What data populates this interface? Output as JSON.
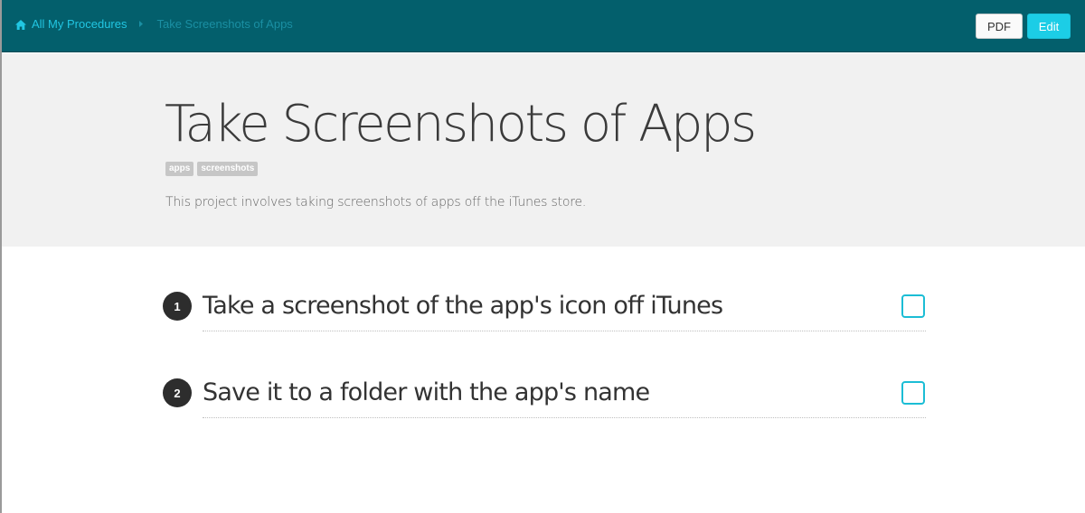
{
  "breadcrumb": {
    "home_label": "All My Procedures",
    "current_label": "Take Screenshots of Apps"
  },
  "toolbar": {
    "pdf_label": "PDF",
    "edit_label": "Edit"
  },
  "procedure": {
    "title": "Take Screenshots of Apps",
    "tags": [
      "apps",
      "screenshots"
    ],
    "description": "This project involves taking screenshots of apps off the iTunes store."
  },
  "steps": [
    {
      "number": "1",
      "text": "Take a screenshot of the app's icon off iTunes",
      "checked": false
    },
    {
      "number": "2",
      "text": "Save it to a folder with the app's name",
      "checked": false
    }
  ],
  "icons": {
    "home": "home-icon",
    "separator": "caret-right-icon"
  },
  "colors": {
    "topbar": "#035f6c",
    "accent": "#1ccde6",
    "link": "#21c6e2",
    "checkbox": "#1bbdd5"
  }
}
